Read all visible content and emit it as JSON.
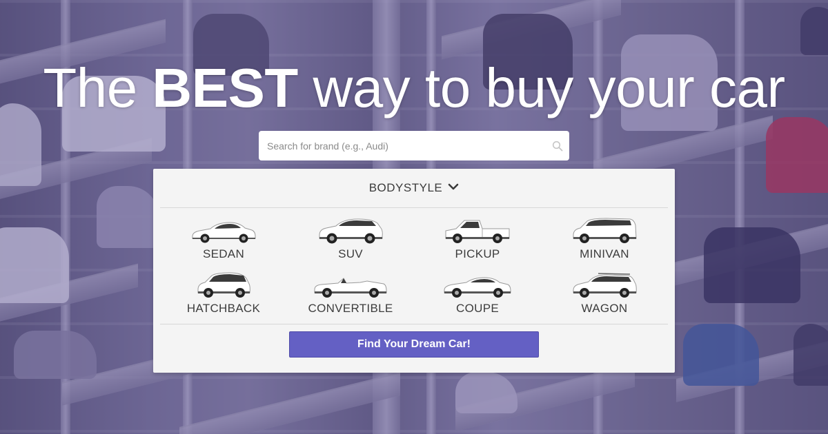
{
  "hero": {
    "headline_prefix": "The ",
    "headline_strong": "BEST",
    "headline_suffix": " way to buy your car"
  },
  "search": {
    "placeholder": "Search for brand (e.g., Audi)",
    "value": "",
    "icon": "search-icon"
  },
  "panel": {
    "dropdown_label": "BODYSTYLE",
    "dropdown_icon": "chevron-down-icon",
    "bodystyles": [
      {
        "label": "SEDAN",
        "icon": "sedan-icon"
      },
      {
        "label": "SUV",
        "icon": "suv-icon"
      },
      {
        "label": "PICKUP",
        "icon": "pickup-icon"
      },
      {
        "label": "MINIVAN",
        "icon": "minivan-icon"
      },
      {
        "label": "HATCHBACK",
        "icon": "hatchback-icon"
      },
      {
        "label": "CONVERTIBLE",
        "icon": "convertible-icon"
      },
      {
        "label": "COUPE",
        "icon": "coupe-icon"
      },
      {
        "label": "WAGON",
        "icon": "wagon-icon"
      }
    ],
    "cta_label": "Find Your Dream Car!"
  },
  "colors": {
    "accent": "#6460c4",
    "panel_bg": "#f4f4f4",
    "overlay": "#5046a0"
  }
}
